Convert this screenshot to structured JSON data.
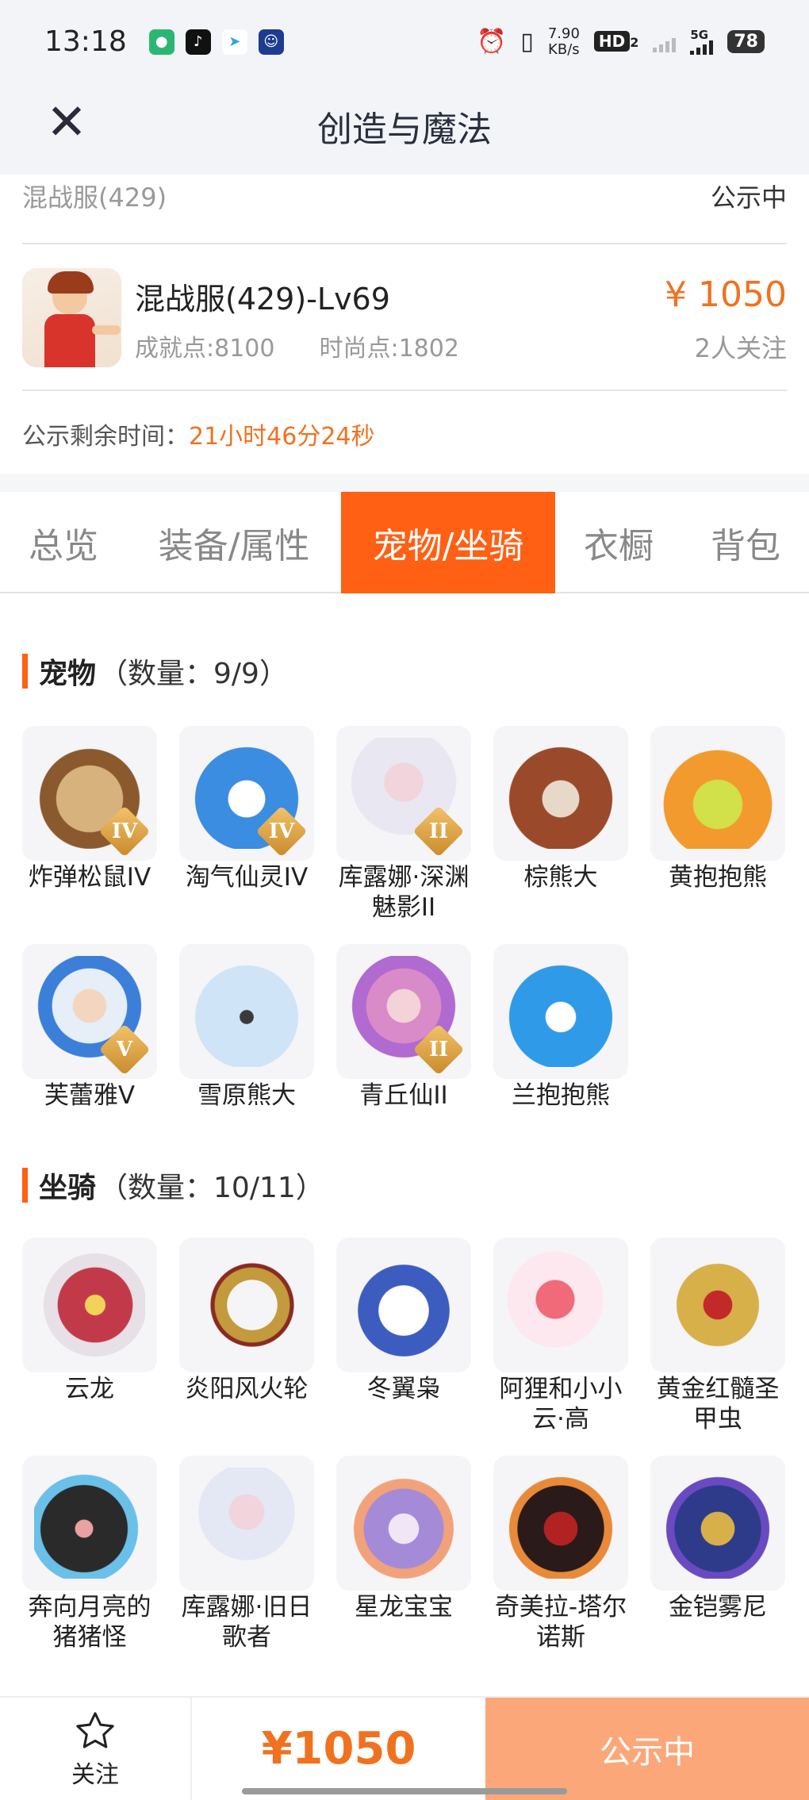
{
  "status_bar": {
    "time": "13:18",
    "speed_value": "7.90",
    "speed_unit": "KB/s",
    "hd": "HD",
    "hd_sub": "2",
    "network": "5G",
    "battery": "78"
  },
  "nav": {
    "close_icon": "close-icon",
    "title": "创造与魔法"
  },
  "server": {
    "name": "混战服(429)",
    "status": "公示中"
  },
  "character": {
    "title": "混战服(429)-Lv69",
    "achievement": "成就点:8100",
    "fashion": "时尚点:1802",
    "price": "¥ 1050",
    "followers": "2人关注"
  },
  "timer": {
    "label": "公示剩余时间：",
    "value": "21小时46分24秒"
  },
  "tabs": [
    "总览",
    "装备/属性",
    "宠物/坐骑",
    "衣橱",
    "背包"
  ],
  "active_tab": "宠物/坐骑",
  "pets": {
    "title": "宠物",
    "count": "（数量：9/9）",
    "items": [
      {
        "label": "炸弹松鼠IV",
        "badge": "IV"
      },
      {
        "label": "淘气仙灵IV",
        "badge": "IV"
      },
      {
        "label": "库露娜·深渊魅影II",
        "badge": "II"
      },
      {
        "label": "棕熊大",
        "badge": ""
      },
      {
        "label": "黄抱抱熊",
        "badge": ""
      },
      {
        "label": "芙蕾雅V",
        "badge": "V"
      },
      {
        "label": "雪原熊大",
        "badge": ""
      },
      {
        "label": "青丘仙II",
        "badge": "II"
      },
      {
        "label": "兰抱抱熊",
        "badge": ""
      }
    ]
  },
  "mounts": {
    "title": "坐骑",
    "count": "（数量：10/11）",
    "items": [
      {
        "label": "云龙"
      },
      {
        "label": "炎阳风火轮"
      },
      {
        "label": "冬翼枭"
      },
      {
        "label": "阿狸和小小云·高"
      },
      {
        "label": "黄金红髓圣甲虫"
      },
      {
        "label": "奔向月亮的猪猪怪"
      },
      {
        "label": "库露娜·旧日歌者"
      },
      {
        "label": "星龙宝宝"
      },
      {
        "label": "奇美拉-塔尔诺斯"
      },
      {
        "label": "金铠雾尼"
      }
    ]
  },
  "bottom": {
    "follow_label": "关注",
    "price": "¥1050",
    "status_button": "公示中"
  },
  "colors": {
    "accent": "#ff6014",
    "price": "#f0721f",
    "status_button": "#fca779"
  }
}
